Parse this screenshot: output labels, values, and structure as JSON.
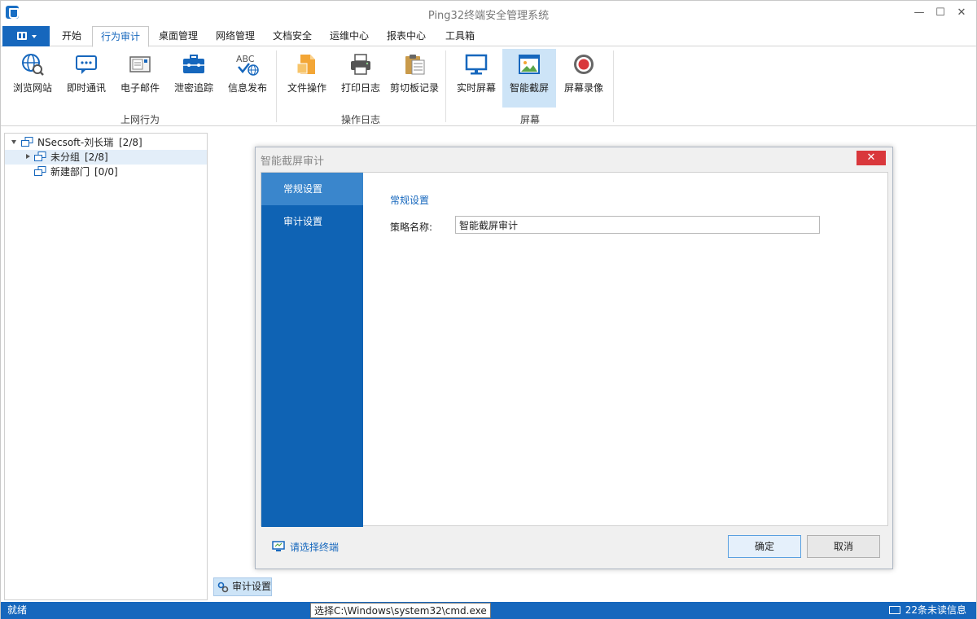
{
  "window": {
    "title": "Ping32终端安全管理系统",
    "minimize": "—",
    "maximize": "☐",
    "close": "✕"
  },
  "menu": {
    "tabs": [
      {
        "label": "开始"
      },
      {
        "label": "行为审计"
      },
      {
        "label": "桌面管理"
      },
      {
        "label": "网络管理"
      },
      {
        "label": "文档安全"
      },
      {
        "label": "运维中心"
      },
      {
        "label": "报表中心"
      },
      {
        "label": "工具箱"
      }
    ],
    "active_tab": "行为审计"
  },
  "ribbon": {
    "groups": [
      {
        "label": "上网行为",
        "buttons": [
          {
            "label": "浏览网站",
            "icon": "globe-search-icon"
          },
          {
            "label": "即时通讯",
            "icon": "chat-icon"
          },
          {
            "label": "电子邮件",
            "icon": "email-icon"
          },
          {
            "label": "泄密追踪",
            "icon": "briefcase-icon"
          },
          {
            "label": "信息发布",
            "icon": "abc-globe-icon"
          }
        ]
      },
      {
        "label": "操作日志",
        "buttons": [
          {
            "label": "文件操作",
            "icon": "file-icon"
          },
          {
            "label": "打印日志",
            "icon": "printer-icon"
          },
          {
            "label": "剪切板记录",
            "icon": "clipboard-icon"
          }
        ]
      },
      {
        "label": "屏幕",
        "buttons": [
          {
            "label": "实时屏幕",
            "icon": "monitor-icon"
          },
          {
            "label": "智能截屏",
            "icon": "picture-icon"
          },
          {
            "label": "屏幕录像",
            "icon": "record-icon"
          }
        ]
      }
    ]
  },
  "tree": {
    "items": [
      {
        "label": "NSecsoft-刘长瑞",
        "count": "[2/8]"
      },
      {
        "label": "未分组",
        "count": "[2/8]"
      },
      {
        "label": "新建部门",
        "count": "[0/0]"
      }
    ]
  },
  "dialog": {
    "title": "智能截屏审计",
    "close": "✕",
    "nav": [
      {
        "label": "常规设置"
      },
      {
        "label": "审计设置"
      }
    ],
    "section_title": "常规设置",
    "policy_label": "策略名称:",
    "policy_value": "智能截屏审计",
    "select_terminal": "请选择终端",
    "ok": "确定",
    "cancel": "取消"
  },
  "bottom_tab": {
    "label": "审计设置"
  },
  "status": {
    "left": "就绪",
    "middle": "选择C:\\Windows\\system32\\cmd.exe",
    "right": "22条未读信息"
  },
  "colors": {
    "accent": "#1667bd",
    "nav": "#0f63b4",
    "nav_active": "#3a86cc",
    "close_red": "#d9383c",
    "selected": "#cde4f7"
  }
}
